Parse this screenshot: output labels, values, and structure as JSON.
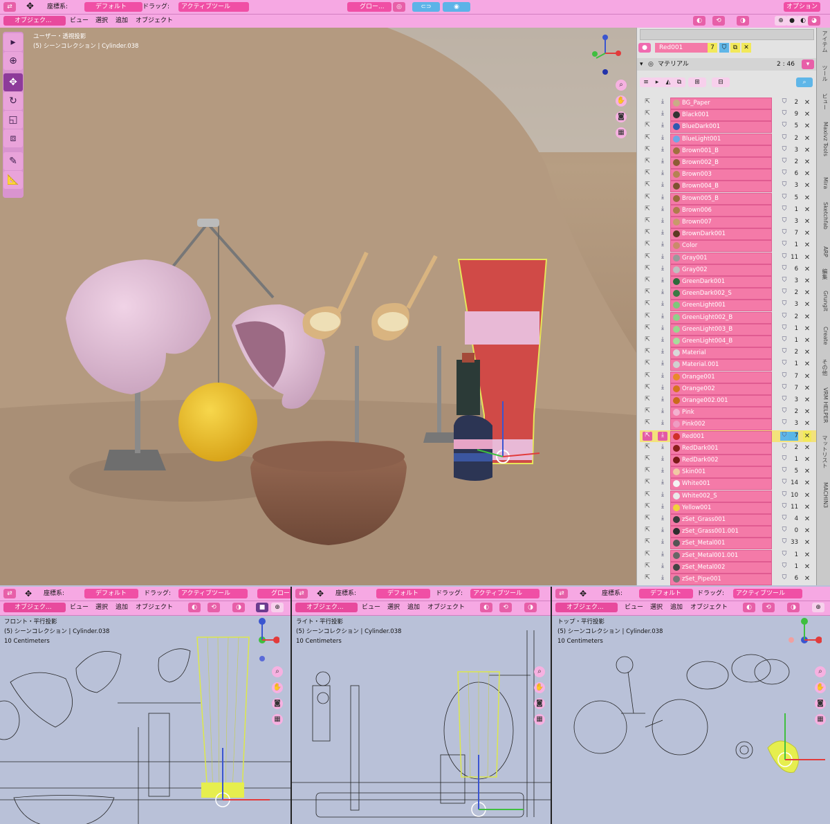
{
  "top_header": {
    "coord_label": "座標系:",
    "coord_value": "デフォルト",
    "drag_label": "ドラッグ:",
    "drag_value": "アクティブツール",
    "pivot_value": "グロー...",
    "options_label": "オプション"
  },
  "top_menu": {
    "mode": "オブジェク...",
    "view": "ビュー",
    "select": "選択",
    "add": "追加",
    "object": "オブジェクト"
  },
  "main_viewport": {
    "title": "ユーザー・透視投影",
    "collection": "(5) シーンコレクション | Cylinder.038"
  },
  "panel": {
    "material_slot": "Red001",
    "user_count": "7",
    "section": "マテリアル",
    "time": "2 : 46",
    "materials": [
      {
        "name": "BG_Paper",
        "count": "2",
        "color": "#c9ad86"
      },
      {
        "name": "Black001",
        "count": "9",
        "color": "#333"
      },
      {
        "name": "BlueDark001",
        "count": "5",
        "color": "#2f5ab0"
      },
      {
        "name": "BlueLight001",
        "count": "2",
        "color": "#6fa7e6"
      },
      {
        "name": "Brown001_B",
        "count": "3",
        "color": "#a0703f"
      },
      {
        "name": "Brown002_B",
        "count": "2",
        "color": "#8d5d35"
      },
      {
        "name": "Brown003",
        "count": "6",
        "color": "#b58353"
      },
      {
        "name": "Brown004_B",
        "count": "3",
        "color": "#7d5230"
      },
      {
        "name": "Brown005_B",
        "count": "5",
        "color": "#9a6a3d"
      },
      {
        "name": "Brown006",
        "count": "1",
        "color": "#ae7c4b"
      },
      {
        "name": "Brown007",
        "count": "3",
        "color": "#c89a6a"
      },
      {
        "name": "BrownDark001",
        "count": "7",
        "color": "#5c3a22"
      },
      {
        "name": "Color",
        "count": "1",
        "color": "#c98b6a"
      },
      {
        "name": "Gray001",
        "count": "11",
        "color": "#9a9a9a"
      },
      {
        "name": "Gray002",
        "count": "6",
        "color": "#c0c0c0"
      },
      {
        "name": "GreenDark001",
        "count": "3",
        "color": "#2f6a3a"
      },
      {
        "name": "GreenDark002_S",
        "count": "2",
        "color": "#3c7a44"
      },
      {
        "name": "GreenLight001",
        "count": "3",
        "color": "#7fc77a"
      },
      {
        "name": "GreenLight002_B",
        "count": "2",
        "color": "#8fd08a"
      },
      {
        "name": "GreenLight003_B",
        "count": "1",
        "color": "#9bd690"
      },
      {
        "name": "GreenLight004_B",
        "count": "1",
        "color": "#a7dc9c"
      },
      {
        "name": "Material",
        "count": "2",
        "color": "#d9d9d9"
      },
      {
        "name": "Material.001",
        "count": "1",
        "color": "#d0d0d0"
      },
      {
        "name": "Orange001",
        "count": "7",
        "color": "#e88a2a"
      },
      {
        "name": "Orange002",
        "count": "7",
        "color": "#d5741f"
      },
      {
        "name": "Orange002.001",
        "count": "3",
        "color": "#c96a1b"
      },
      {
        "name": "Pink",
        "count": "2",
        "color": "#f3b1cf"
      },
      {
        "name": "Pink002",
        "count": "3",
        "color": "#ee9dc3"
      },
      {
        "name": "Red001",
        "count": "7",
        "color": "#d0302a",
        "active": true
      },
      {
        "name": "RedDark001",
        "count": "2",
        "color": "#8a1f1c"
      },
      {
        "name": "RedDark002",
        "count": "1",
        "color": "#7a1a18"
      },
      {
        "name": "Skin001",
        "count": "5",
        "color": "#f1c9a4"
      },
      {
        "name": "White001",
        "count": "14",
        "color": "#f3f3f3"
      },
      {
        "name": "White002_S",
        "count": "10",
        "color": "#e9e9e9"
      },
      {
        "name": "Yellow001",
        "count": "11",
        "color": "#f1d23a"
      },
      {
        "name": "zSet_Grass001",
        "count": "4",
        "color": "#3a3a3a"
      },
      {
        "name": "zSet_Grass001.001",
        "count": "0",
        "color": "#2e2e2e"
      },
      {
        "name": "zSet_Metal001",
        "count": "33",
        "color": "#555"
      },
      {
        "name": "zSet_Metal001.001",
        "count": "1",
        "color": "#666"
      },
      {
        "name": "zSet_Metal002",
        "count": "1",
        "color": "#444"
      },
      {
        "name": "zSet_Pipe001",
        "count": "6",
        "color": "#777"
      }
    ]
  },
  "side_tabs": [
    "アイテム",
    "ツール",
    "ビュー",
    "Maxivz Tools",
    "Mira",
    "Sketchfab",
    "ARP",
    "編集",
    "Grungit",
    "Create",
    "その他",
    "VRM HELPER",
    "マットリスト",
    "MACHIN3"
  ],
  "bottom_views": [
    {
      "coord_label": "座標系:",
      "coord_value": "デフォルト",
      "drag_label": "ドラッグ:",
      "drag_value": "アクティブツール",
      "pivot": "グロー",
      "mode": "オブジェク...",
      "view": "ビュー",
      "select": "選択",
      "add": "追加",
      "object": "オブジェクト",
      "title": "フロント・平行投影",
      "collection": "(5) シーンコレクション | Cylinder.038",
      "scale": "10 Centimeters"
    },
    {
      "coord_label": "座標系:",
      "coord_value": "デフォルト",
      "drag_label": "ドラッグ:",
      "drag_value": "アクティブツール",
      "pivot": "",
      "mode": "オブジェク...",
      "view": "ビュー",
      "select": "選択",
      "add": "追加",
      "object": "オブジェクト",
      "title": "ライト・平行投影",
      "collection": "(5) シーンコレクション | Cylinder.038",
      "scale": "10 Centimeters"
    },
    {
      "coord_label": "座標系:",
      "coord_value": "デフォルト",
      "drag_label": "ドラッグ:",
      "drag_value": "アクティブツール",
      "pivot": "",
      "mode": "オブジェク...",
      "view": "ビュー",
      "select": "選択",
      "add": "追加",
      "object": "オブジェクト",
      "title": "トップ・平行投影",
      "collection": "(5) シーンコレクション | Cylinder.038",
      "scale": "10 Centimeters"
    }
  ]
}
